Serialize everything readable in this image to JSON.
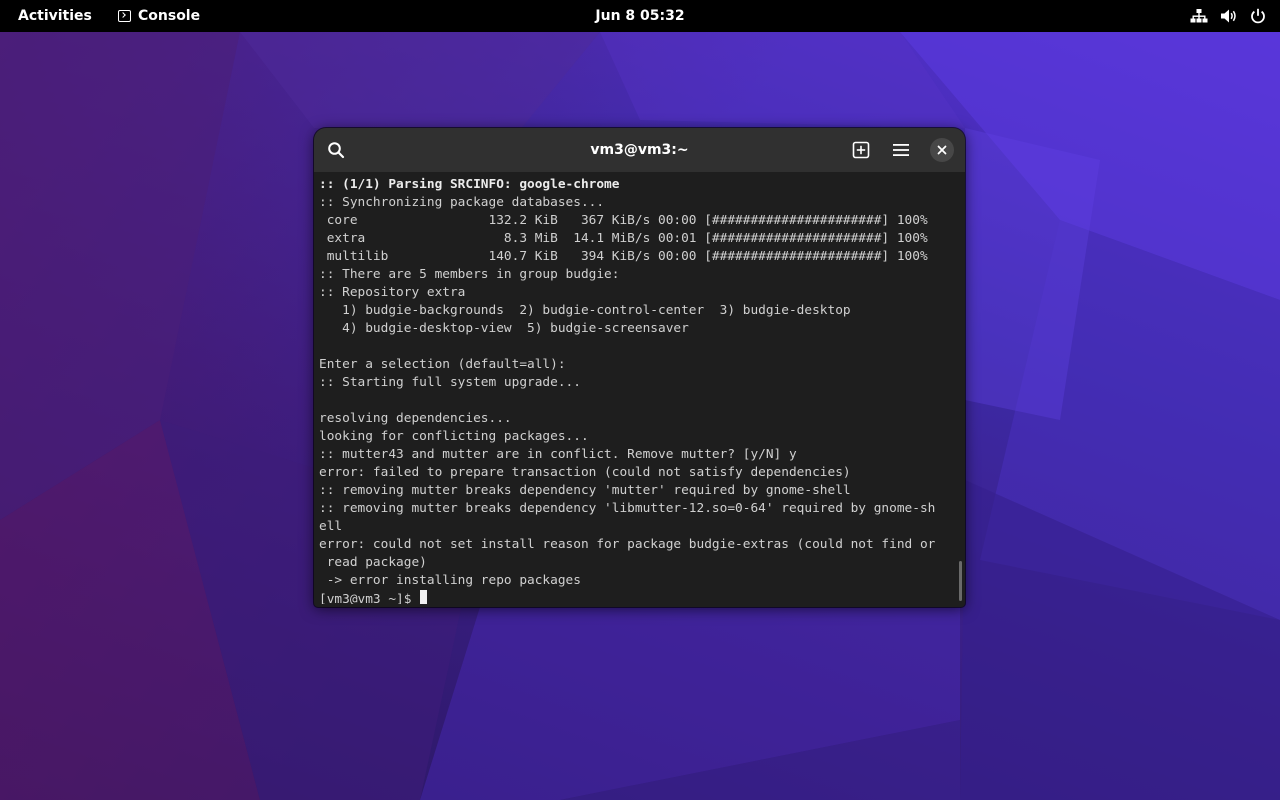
{
  "topbar": {
    "activities_label": "Activities",
    "app_label": "Console",
    "clock": "Jun 8  05:32",
    "status_icons": [
      "network-icon",
      "volume-icon",
      "power-icon"
    ]
  },
  "terminal": {
    "title": "vm3@vm3:~",
    "header_icons": [
      "search-icon",
      "new-tab-icon",
      "hamburger-menu-icon",
      "close-icon"
    ],
    "lines": [
      {
        "text": ":: (1/1) Parsing SRCINFO: google-chrome",
        "bold": true
      },
      {
        "text": ":: Synchronizing package databases..."
      },
      {
        "text": " core                 132.2 KiB   367 KiB/s 00:00 [######################] 100%"
      },
      {
        "text": " extra                  8.3 MiB  14.1 MiB/s 00:01 [######################] 100%"
      },
      {
        "text": " multilib             140.7 KiB   394 KiB/s 00:00 [######################] 100%"
      },
      {
        "text": ":: There are 5 members in group budgie:"
      },
      {
        "text": ":: Repository extra"
      },
      {
        "text": "   1) budgie-backgrounds  2) budgie-control-center  3) budgie-desktop"
      },
      {
        "text": "   4) budgie-desktop-view  5) budgie-screensaver"
      },
      {
        "text": ""
      },
      {
        "text": "Enter a selection (default=all):"
      },
      {
        "text": ":: Starting full system upgrade..."
      },
      {
        "text": ""
      },
      {
        "text": "resolving dependencies..."
      },
      {
        "text": "looking for conflicting packages..."
      },
      {
        "text": ":: mutter43 and mutter are in conflict. Remove mutter? [y/N] y"
      },
      {
        "text": "error: failed to prepare transaction (could not satisfy dependencies)"
      },
      {
        "text": ":: removing mutter breaks dependency 'mutter' required by gnome-shell"
      },
      {
        "text": ":: removing mutter breaks dependency 'libmutter-12.so=0-64' required by gnome-sh"
      },
      {
        "text": "ell"
      },
      {
        "text": "error: could not set install reason for package budgie-extras (could not find or"
      },
      {
        "text": " read package)"
      },
      {
        "text": " -> error installing repo packages"
      }
    ],
    "prompt": "[vm3@vm3 ~]$ "
  }
}
